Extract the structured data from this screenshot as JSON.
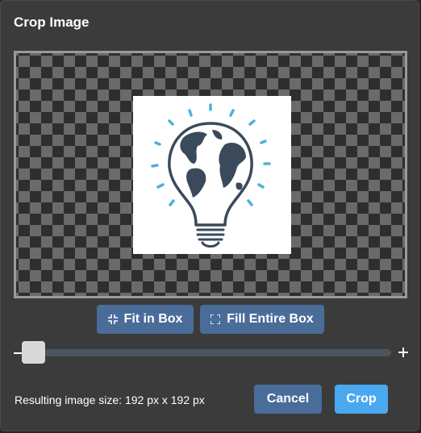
{
  "dialog": {
    "title": "Crop Image"
  },
  "toolbar": {
    "fit_label": "Fit in Box",
    "fill_label": "Fill Entire Box"
  },
  "zoom": {
    "minus_icon": "minus-icon",
    "plus_icon": "plus-icon",
    "level": 0.02
  },
  "footer": {
    "result_text": "Resulting image size: 192 px x 192 px",
    "cancel_label": "Cancel",
    "crop_label": "Crop"
  },
  "colors": {
    "dialog_bg": "#3b3b3b",
    "secondary_button": "#4a6c99",
    "primary_button": "#4aa8f0",
    "globe_outline": "#3a4a5a",
    "accent_ray": "#4ab3d9"
  },
  "icons": {
    "fit": "compress-icon",
    "fill": "expand-icon",
    "image": "lightbulb-globe-icon"
  }
}
